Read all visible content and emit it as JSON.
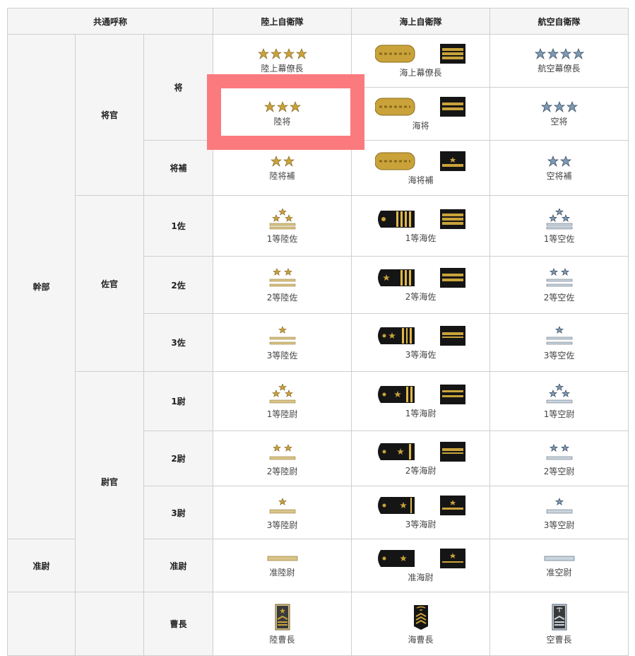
{
  "headers": {
    "common": "共通呼称",
    "gsdf": "陸上自衛隊",
    "msdf": "海上自衛隊",
    "asdf": "航空自衛隊"
  },
  "groups": {
    "kanbu": "幹部",
    "shokan": "将官",
    "sakan": "佐官",
    "ikan": "尉官",
    "junni": "准尉"
  },
  "ranks": [
    {
      "grade": "将",
      "gsdf": "陸上幕僚長",
      "msdf": "海上幕僚長",
      "asdf": "航空幕僚長"
    },
    {
      "grade": "",
      "gsdf": "陸将",
      "msdf": "海将",
      "asdf": "空将"
    },
    {
      "grade": "将補",
      "gsdf": "陸将補",
      "msdf": "海将補",
      "asdf": "空将補"
    },
    {
      "grade": "1佐",
      "gsdf": "1等陸佐",
      "msdf": "1等海佐",
      "asdf": "1等空佐"
    },
    {
      "grade": "2佐",
      "gsdf": "2等陸佐",
      "msdf": "2等海佐",
      "asdf": "2等空佐"
    },
    {
      "grade": "3佐",
      "gsdf": "3等陸佐",
      "msdf": "3等海佐",
      "asdf": "3等空佐"
    },
    {
      "grade": "1尉",
      "gsdf": "1等陸尉",
      "msdf": "1等海尉",
      "asdf": "1等空尉"
    },
    {
      "grade": "2尉",
      "gsdf": "2等陸尉",
      "msdf": "2等海尉",
      "asdf": "2等空尉"
    },
    {
      "grade": "3尉",
      "gsdf": "3等陸尉",
      "msdf": "3等海尉",
      "asdf": "3等空尉"
    },
    {
      "grade": "准尉",
      "gsdf": "准陸尉",
      "msdf": "准海尉",
      "asdf": "准空尉"
    },
    {
      "grade": "曹長",
      "gsdf": "陸曹長",
      "msdf": "海曹長",
      "asdf": "空曹長"
    }
  ],
  "colors": {
    "header_bg": "#f5f5f5",
    "border": "#cfcfcf",
    "highlight": "#fa7a7e",
    "gold": "#c9a33a",
    "silver_blue": "#7f9ab5",
    "navy_black": "#151515"
  }
}
